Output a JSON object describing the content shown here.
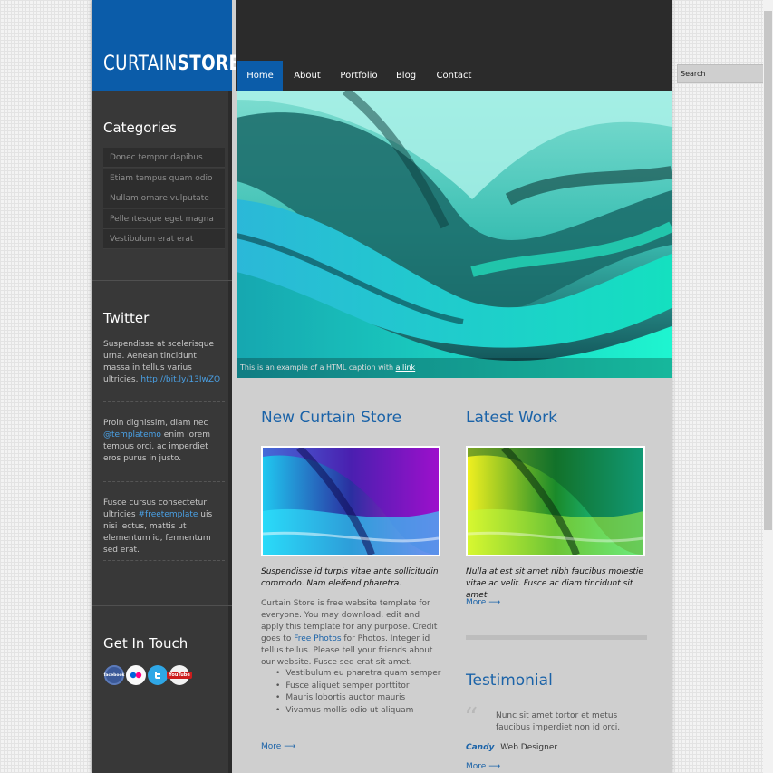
{
  "logo": {
    "light": "CURTAIN",
    "bold": "STORE"
  },
  "nav": [
    {
      "label": "Home",
      "active": true
    },
    {
      "label": "About"
    },
    {
      "label": "Portfolio"
    },
    {
      "label": "Blog"
    },
    {
      "label": "Contact"
    }
  ],
  "search": {
    "placeholder": "Search",
    "value": "Search"
  },
  "sidebar": {
    "categories_title": "Categories",
    "categories": [
      "Donec tempor dapibus",
      "Etiam tempus quam odio",
      "Nullam ornare vulputate",
      "Pellentesque eget magna",
      "Vestibulum erat erat"
    ],
    "twitter_title": "Twitter",
    "tweets": [
      {
        "text": "Suspendisse at scelerisque urna. Aenean tincidunt massa in tellus varius ultricies.",
        "link": "http://bit.ly/13IwZO"
      },
      {
        "pre": "Proin dignissim, diam nec",
        "link": "@templatemo",
        "post": "enim lorem tempus orci, ac imperdiet eros purus in justo."
      },
      {
        "pre": "Fusce cursus consectetur ultricies",
        "link": "#freetemplate",
        "post": "uis nisi lectus, mattis ut elementum id, fermentum sed erat."
      }
    ],
    "contact_title": "Get In Touch",
    "social": [
      "facebook",
      "flickr",
      "twitter",
      "YouTube"
    ]
  },
  "banner": {
    "caption": "This is an example of a HTML caption with",
    "caption_link": "a link"
  },
  "left_col": {
    "title": "New Curtain Store",
    "italic": "Suspendisse id turpis vitae ante sollicitudin commodo. Nam eleifend pharetra.",
    "para_pre": "Curtain Store is free website template for everyone. You may download, edit and apply this template for any purpose. Credit goes to",
    "para_link": "Free Photos",
    "para_post": "for Photos. Integer id tellus tellus. Please tell your friends about our website. Fusce sed erat sit amet.",
    "bullets": [
      "Vestibulum eu pharetra quam semper",
      "Fusce aliquet semper porttitor",
      "Mauris lobortis auctor mauris",
      "Vivamus mollis odio ut aliquam"
    ],
    "more": "More"
  },
  "right_col": {
    "title": "Latest Work",
    "italic": "Nulla at est sit amet nibh faucibus molestie vitae ac velit. Fusce ac diam tincidunt sit amet.",
    "more": "More",
    "testimonial_title": "Testimonial",
    "quote": "Nunc sit amet tortor et metus faucibus imperdiet non id orci.",
    "author": "Candy",
    "role": "Web Designer",
    "more2": "More"
  },
  "colors": {
    "brand": "#0b5ca9",
    "sidebar": "#383838",
    "accent_link": "#1b63a8"
  }
}
